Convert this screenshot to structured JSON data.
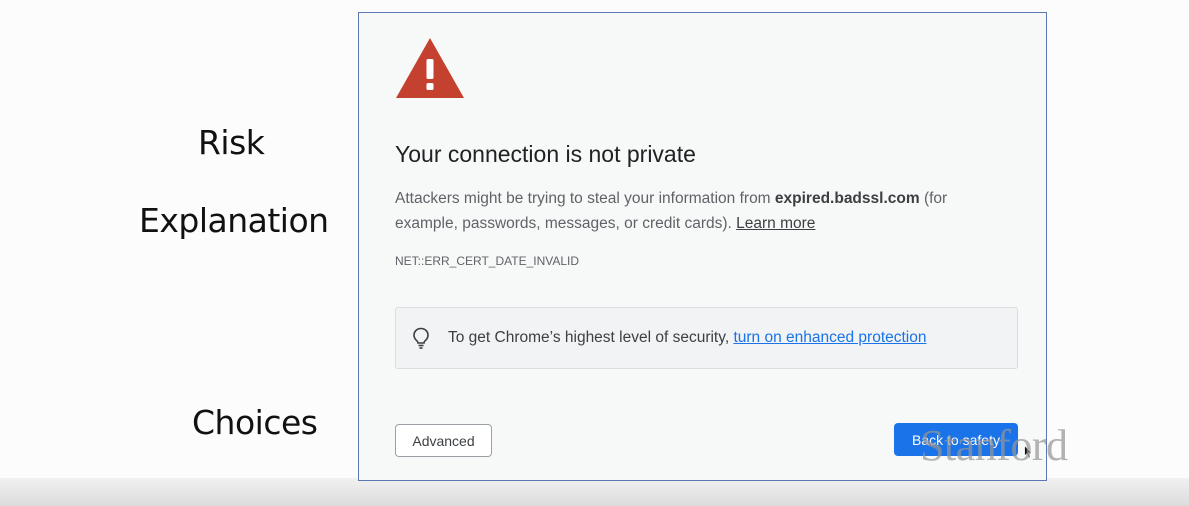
{
  "labels": {
    "risk": "Risk",
    "explanation": "Explanation",
    "choices": "Choices"
  },
  "interstitial": {
    "icon": "warning-triangle-icon",
    "icon_color": "#c5412f",
    "heading": "Your connection is not private",
    "explanation_prefix": "Attackers might be trying to steal your information from ",
    "domain": "expired.badssl.com",
    "explanation_suffix": " (for example, passwords, messages, or credit cards). ",
    "learn_more": "Learn more",
    "error_code": "NET::ERR_CERT_DATE_INVALID",
    "tip": {
      "icon": "lightbulb-icon",
      "text": "To get Chrome’s highest level of security, ",
      "link": "turn on enhanced protection",
      "link_color": "#1a73e8"
    },
    "advanced_label": "Advanced",
    "back_label": "Back to safety",
    "primary_color": "#1a73e8"
  },
  "watermark": "Stanford"
}
